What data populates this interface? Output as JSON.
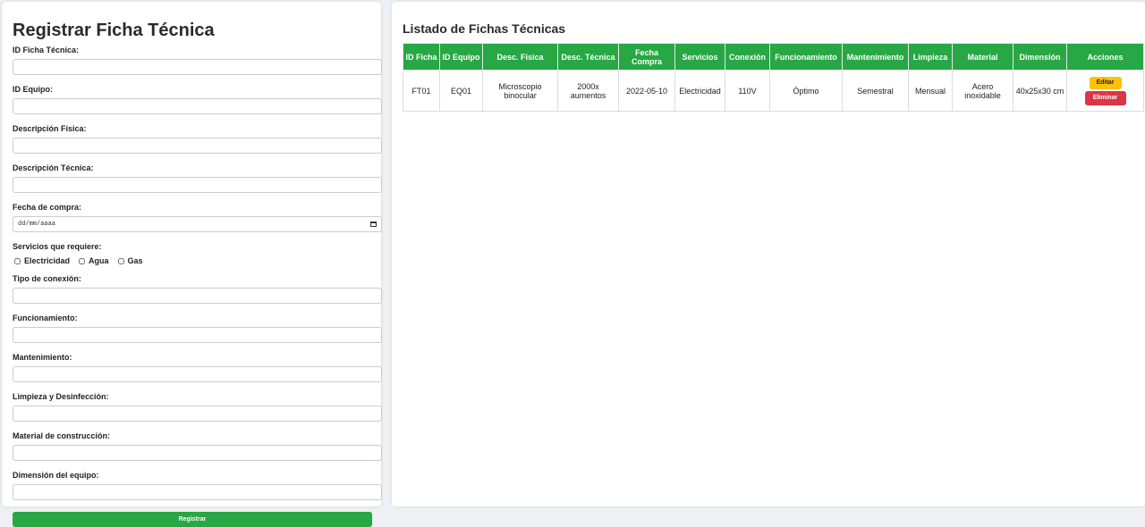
{
  "form": {
    "title": "Registrar Ficha Técnica",
    "fields": [
      {
        "label": "ID Ficha Técnica:",
        "value": ""
      },
      {
        "label": "ID Equipo:",
        "value": ""
      },
      {
        "label": "Descripción Física:",
        "value": ""
      },
      {
        "label": "Descripción Técnica:",
        "value": ""
      }
    ],
    "date_field": {
      "label": "Fecha de compra:",
      "placeholder": "dd/mm/aaaa"
    },
    "services": {
      "label": "Servicios que requiere:",
      "options": [
        "Electricidad",
        "Agua",
        "Gas"
      ]
    },
    "fields_after": [
      {
        "label": "Tipo de conexión:",
        "value": ""
      },
      {
        "label": "Funcionamiento:",
        "value": ""
      },
      {
        "label": "Mantenimiento:",
        "value": ""
      },
      {
        "label": "Limpieza y Desinfección:",
        "value": ""
      },
      {
        "label": "Material de construcción:",
        "value": ""
      },
      {
        "label": "Dimensión del equipo:",
        "value": ""
      }
    ],
    "submit_label": "Registrar"
  },
  "list": {
    "title": "Listado de Fichas Técnicas",
    "headers": [
      "ID Ficha",
      "ID Equipo",
      "Desc. Física",
      "Desc. Técnica",
      "Fecha Compra",
      "Servicios",
      "Conexión",
      "Funcionamiento",
      "Mantenimiento",
      "Limpieza",
      "Material",
      "Dimensión",
      "Acciones"
    ],
    "rows": [
      {
        "cells": [
          "FT01",
          "EQ01",
          "Microscopio binocular",
          "2000x aumentos",
          "2022-05-10",
          "Electricidad",
          "110V",
          "Óptimo",
          "Semestral",
          "Mensual",
          "Acero inoxidable",
          "40x25x30 cm"
        ],
        "edit_label": "Editar",
        "delete_label": "Eliminar"
      }
    ]
  },
  "colors": {
    "accent": "#28a745",
    "edit": "#ffc107",
    "delete": "#dc3545"
  }
}
